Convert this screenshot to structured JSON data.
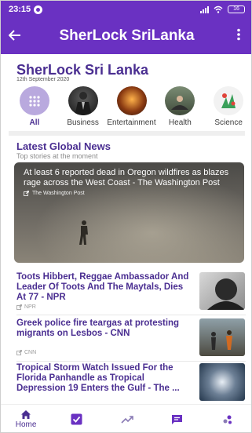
{
  "status": {
    "time": "23:15",
    "battery": "16"
  },
  "appbar": {
    "title": "SherLock SriLanka",
    "back_icon": "arrow-left-icon",
    "menu_icon": "more-vertical-icon"
  },
  "header": {
    "brand": "SherLock Sri Lanka",
    "date": "12th September 2020"
  },
  "categories": [
    {
      "label": "All",
      "icon": "grid-icon"
    },
    {
      "label": "Business",
      "icon": "business-image"
    },
    {
      "label": "Entertainment",
      "icon": "entertainment-image"
    },
    {
      "label": "Health",
      "icon": "health-image"
    },
    {
      "label": "Science",
      "icon": "science-image"
    }
  ],
  "section": {
    "title": "Latest Global News",
    "subtitle": "Top stories at the moment"
  },
  "hero": {
    "title": "At least 6 reported dead in Oregon wildfires as blazes rage across the West Coast - The Washington Post",
    "source": "The Washington Post"
  },
  "articles": [
    {
      "title": "Toots Hibbert, Reggae Ambassador And Leader Of Toots And The Maytals, Dies At 77 - NPR",
      "source": "NPR"
    },
    {
      "title": "Greek police fire teargas at protesting migrants on Lesbos - CNN",
      "source": "CNN"
    },
    {
      "title": "Tropical Storm Watch Issued For the Florida Panhandle as Tropical Depression 19 Enters the Gulf - The ...",
      "source": ""
    }
  ],
  "nav": {
    "home_label": "Home"
  },
  "colors": {
    "primary": "#6a31c2",
    "accent_text": "#4a2e91"
  }
}
